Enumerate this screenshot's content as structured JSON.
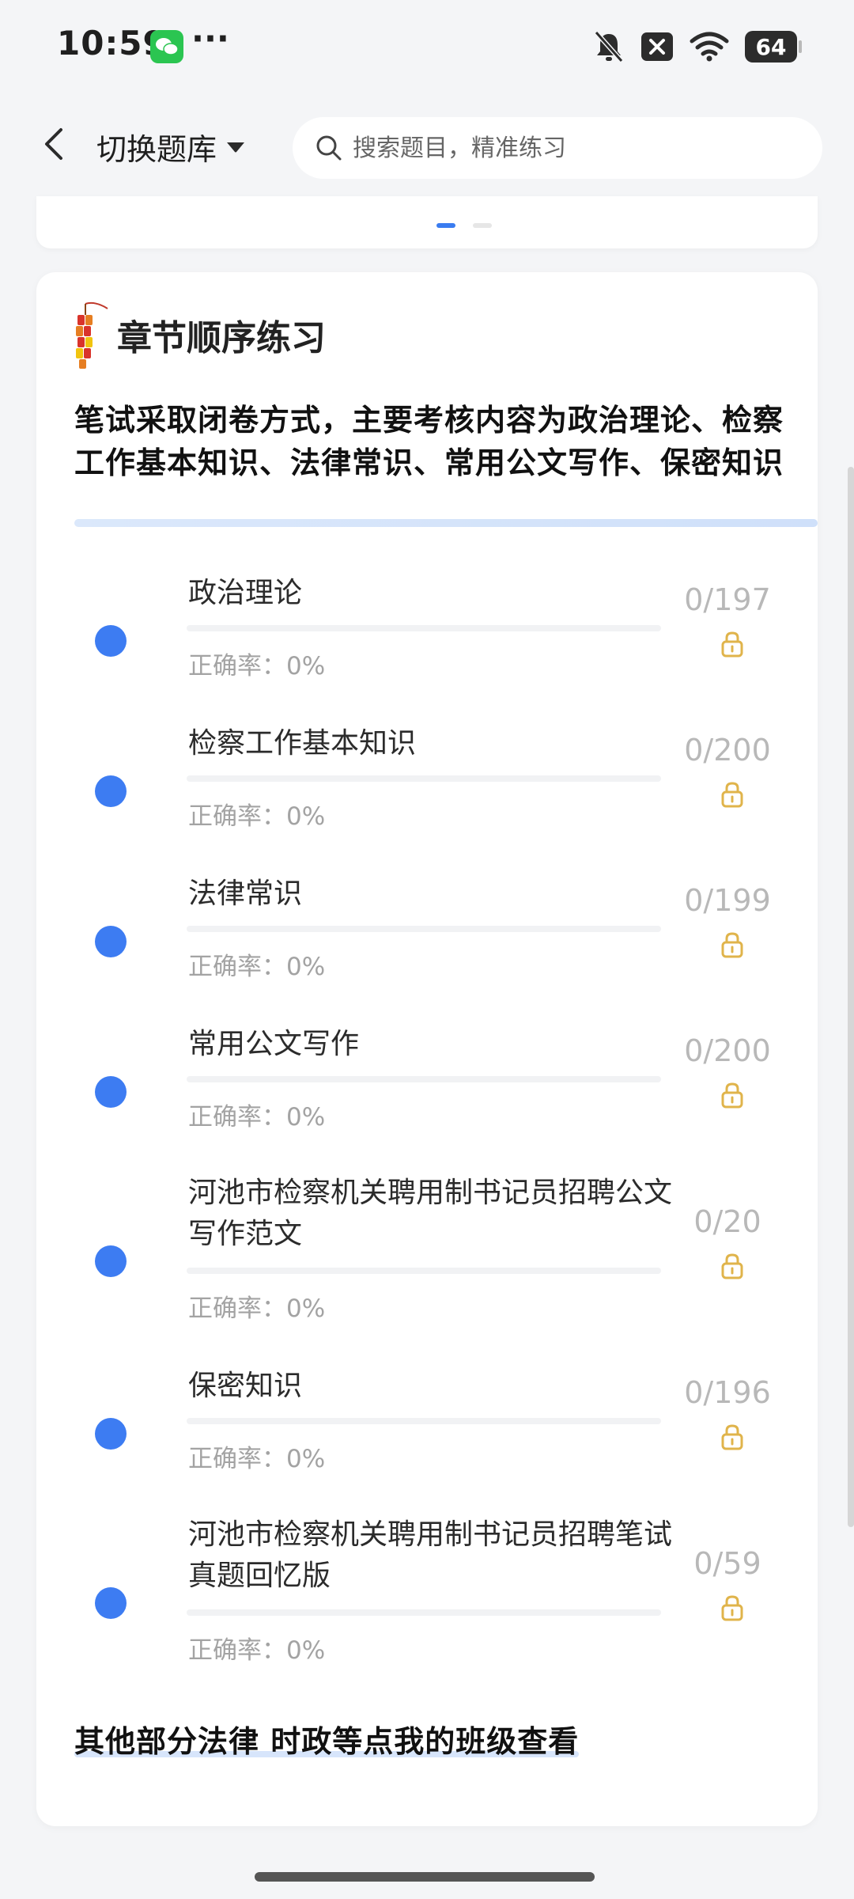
{
  "status_bar": {
    "time": "10:59",
    "dots": "···",
    "battery": "64"
  },
  "header": {
    "bank_switch_label": "切换题库",
    "search_placeholder": "搜索题目，精准练习"
  },
  "carousel": {
    "active_index": 0,
    "page_count": 2
  },
  "chapter_card": {
    "title": "章节顺序练习",
    "description": "笔试采取闭卷方式，主要考核内容为政治理论、检察工作基本知识、法律常识、常用公文写作、保密知识",
    "accuracy_label": "正确率：",
    "chapters": [
      {
        "name": "政治理论",
        "accuracy": "0%",
        "count": "0/197",
        "progress": 0
      },
      {
        "name": "检察工作基本知识",
        "accuracy": "0%",
        "count": "0/200",
        "progress": 0
      },
      {
        "name": "法律常识",
        "accuracy": "0%",
        "count": "0/199",
        "progress": 0
      },
      {
        "name": "常用公文写作",
        "accuracy": "0%",
        "count": "0/200",
        "progress": 0
      },
      {
        "name": "河池市检察机关聘用制书记员招聘公文写作范文",
        "accuracy": "0%",
        "count": "0/20",
        "progress": 0
      },
      {
        "name": "保密知识",
        "accuracy": "0%",
        "count": "0/196",
        "progress": 0
      },
      {
        "name": "河池市检察机关聘用制书记员招聘笔试真题回忆版",
        "accuracy": "0%",
        "count": "0/59",
        "progress": 0
      }
    ],
    "footer_link": "其他部分法律 时政等点我的班级查看"
  },
  "colors": {
    "accent": "#3d7cf2",
    "lock": "#e0b44b",
    "count_text": "#b8b8b8",
    "muted_text": "#a3a3a3"
  },
  "icons": {
    "back": "chevron-left-icon",
    "dropdown": "caret-down-icon",
    "search": "search-icon",
    "title": "firecracker-icon",
    "lock": "lock-icon"
  }
}
